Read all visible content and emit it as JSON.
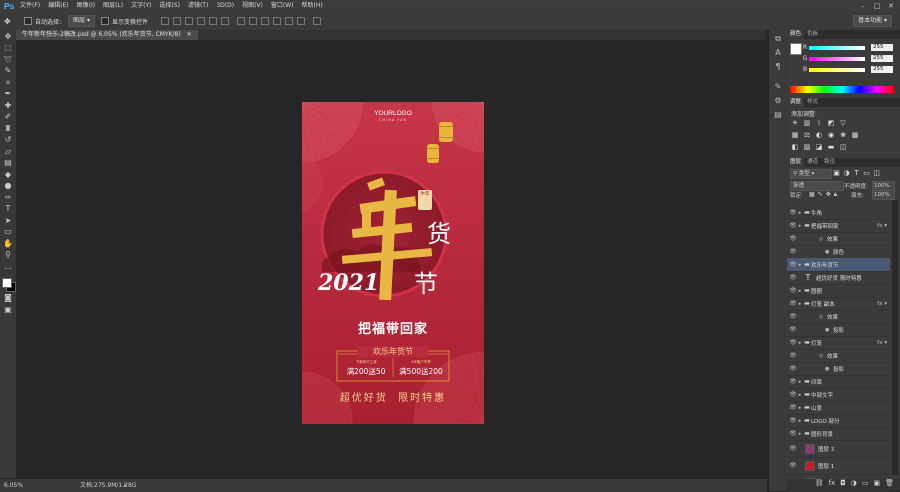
{
  "menubar": {
    "logo": "Ps",
    "items": [
      "文件(F)",
      "编辑(E)",
      "图像(I)",
      "图层(L)",
      "文字(Y)",
      "选择(S)",
      "滤镜(T)",
      "3D(D)",
      "视图(V)",
      "窗口(W)",
      "帮助(H)"
    ],
    "window_controls": [
      "–",
      "□",
      "✕"
    ]
  },
  "options": {
    "auto_select_label": "自动选择：",
    "auto_select_value": "图层",
    "show_transform_label": "显示变换控件",
    "workspace": "基本功能"
  },
  "document": {
    "tab_title": "牛年新年快乐-2稿改.psd @ 6.05% (欢乐年货节, CMYK/8)",
    "zoom": "6.05%",
    "doc_size": "文档:275.9M/1.28G"
  },
  "poster": {
    "logo": "YOURLOGO",
    "logo_sub": "CHINA FAB",
    "big_char": "年",
    "huo": "货",
    "jie": "节",
    "year": "2021",
    "seal": "牛年",
    "fu_line": "把福带回家",
    "festival": "欢乐年货节",
    "coupon1_small": "下单即可立减",
    "coupon1_main": "满200送50",
    "coupon2_small": "VIP客户专享",
    "coupon2_main": "满500送200",
    "footer": "超优好货  限时特惠"
  },
  "panels": {
    "color_tabs": [
      "颜色",
      "色板"
    ],
    "rgb": [
      {
        "label": "R",
        "value": "255"
      },
      {
        "label": "G",
        "value": "255"
      },
      {
        "label": "B",
        "value": "255"
      }
    ],
    "adj_tabs": [
      "调整",
      "样式"
    ],
    "adj_title": "添加调整",
    "layer_tabs": [
      "图层",
      "通道",
      "路径"
    ],
    "kind_label": "类型",
    "blend_mode": "穿透",
    "opacity_label": "不透明度:",
    "opacity": "100%",
    "lock_label": "锁定:",
    "fill_label": "填充:",
    "fill": "100%",
    "layers": [
      {
        "name": "牛角",
        "type": "folder",
        "fx": false
      },
      {
        "name": "把福带回家",
        "type": "folder",
        "fx": true
      },
      {
        "name": "效果",
        "type": "sub",
        "fx": false
      },
      {
        "name": "颜色",
        "type": "sub2",
        "fx": false
      },
      {
        "name": "欢乐年货节",
        "type": "folder",
        "fx": false,
        "selected": true
      },
      {
        "name": "超优好货 限时特惠",
        "type": "text",
        "fx": false
      },
      {
        "name": "圆圈",
        "type": "folder",
        "fx": false
      },
      {
        "name": "灯笼 副本",
        "type": "folder",
        "fx": true
      },
      {
        "name": "效果",
        "type": "sub",
        "fx": false
      },
      {
        "name": "投影",
        "type": "sub2",
        "fx": false
      },
      {
        "name": "灯笼",
        "type": "folder",
        "fx": true
      },
      {
        "name": "效果",
        "type": "sub",
        "fx": false
      },
      {
        "name": "投影",
        "type": "sub2",
        "fx": false
      },
      {
        "name": "印章",
        "type": "folder",
        "fx": false
      },
      {
        "name": "中部文字",
        "type": "folder",
        "fx": false
      },
      {
        "name": "山景",
        "type": "folder",
        "fx": false
      },
      {
        "name": "LOGO 部分",
        "type": "folder",
        "fx": false
      },
      {
        "name": "圆形背景",
        "type": "folder",
        "fx": false
      },
      {
        "name": "图层 3",
        "type": "pixel",
        "thumb": "#8a3b6a"
      },
      {
        "name": "图层 1",
        "type": "pixel",
        "thumb": "#c0202a"
      },
      {
        "name": "背景",
        "type": "bg",
        "thumb": "#ffffff"
      }
    ]
  },
  "colors": {
    "accent_gold": "#e8b63a",
    "poster_red": "#b82a3e",
    "selection": "#4a5a73"
  }
}
